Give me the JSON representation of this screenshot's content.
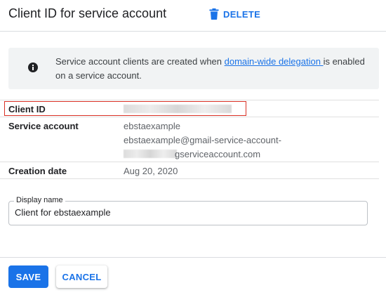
{
  "header": {
    "title": "Client ID for service account",
    "delete_label": "DELETE",
    "delete_icon": "trash-icon"
  },
  "banner": {
    "icon": "info-icon",
    "text_before": "Service account clients are created when ",
    "link_text": "domain-wide delegation ",
    "text_after": "is enabled on a service account."
  },
  "details": {
    "client_id": {
      "label": "Client ID"
    },
    "service_account": {
      "label": "Service account",
      "line1": "ebstaexample",
      "line2": "ebstaexample@gmail-service-account-",
      "line3_suffix": "gserviceaccount.com"
    },
    "creation_date": {
      "label": "Creation date",
      "value": "Aug 20, 2020"
    }
  },
  "display_name": {
    "label": "Display name",
    "value": "Client for ebstaexample"
  },
  "footer": {
    "save_label": "SAVE",
    "cancel_label": "CANCEL"
  },
  "colors": {
    "accent": "#1a73e8",
    "highlight_border": "#d93025",
    "banner_bg": "#f1f3f4"
  }
}
